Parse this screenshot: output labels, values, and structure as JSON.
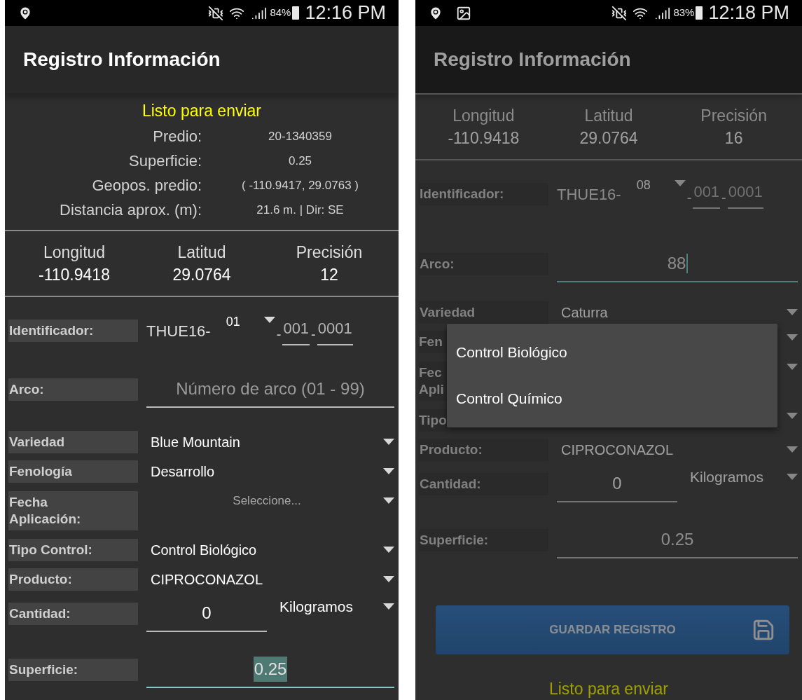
{
  "phones": [
    {
      "dimmed": false,
      "status_bar": {
        "notifications": [
          {
            "kind": "location"
          }
        ],
        "battery": "84%",
        "time": "12:16 PM"
      },
      "title": "Registro Información",
      "info": {
        "status": "Listo para enviar",
        "rows": [
          {
            "label": "Predio:",
            "value": "20-1340359"
          },
          {
            "label": "Superficie:",
            "value": "0.25"
          },
          {
            "label": "Geopos. predio:",
            "value": "( -110.9417, 29.0763 )"
          },
          {
            "label": "Distancia aprox. (m):",
            "value": "21.6 m. | Dir: SE"
          }
        ]
      },
      "gps": [
        {
          "label": "Longitud",
          "value": "-110.9418"
        },
        {
          "label": "Latitud",
          "value": "29.0764"
        },
        {
          "label": "Precisión",
          "value": "12"
        }
      ],
      "form": [
        {
          "kind": "identifier",
          "label": "Identificador:",
          "prefix": "THUE16-",
          "spinner": "01",
          "separators": [
            "-",
            "-"
          ],
          "fields": [
            "001",
            "0001"
          ]
        },
        {
          "kind": "text",
          "label": "Arco:",
          "placeholder": "Número de arco (01 - 99)",
          "focused": false
        },
        {
          "kind": "spinner",
          "label": "Variedad",
          "value": "Blue Mountain"
        },
        {
          "kind": "spinner",
          "label": "Fenología",
          "value": "Desarrollo"
        },
        {
          "kind": "hint_spinner",
          "label": "Fecha\nAplicación:",
          "placeholder": "Seleccione..."
        },
        {
          "kind": "spinner",
          "label": "Tipo Control:",
          "value": "Control Biológico"
        },
        {
          "kind": "spinner",
          "label": "Producto:",
          "value": "CIPROCONAZOL"
        },
        {
          "kind": "quantity",
          "label": "Cantidad:",
          "value": "0",
          "unit": "Kilogramos"
        },
        {
          "kind": "text",
          "label": "Superficie:",
          "value": "0.25",
          "focused": true,
          "highlighted": true
        }
      ]
    },
    {
      "dimmed": true,
      "status_bar": {
        "notifications": [
          {
            "kind": "location"
          },
          {
            "kind": "image"
          }
        ],
        "battery": "83%",
        "time": "12:18 PM"
      },
      "title": "Registro Información",
      "gps": [
        {
          "label": "Longitud",
          "value": "-110.9418"
        },
        {
          "label": "Latitud",
          "value": "29.0764"
        },
        {
          "label": "Precisión",
          "value": "16"
        }
      ],
      "form": [
        {
          "kind": "identifier",
          "label": "Identificador:",
          "prefix": "THUE16-",
          "spinner": "08",
          "separators": [
            "-",
            "-"
          ],
          "fields": [
            "001",
            "0001"
          ]
        },
        {
          "kind": "text",
          "label": "Arco:",
          "value": "88",
          "focused": true,
          "highlighted": false
        },
        {
          "kind": "spinner",
          "label": "Variedad",
          "value": "Caturra"
        },
        {
          "kind": "covered",
          "label": "Fen"
        },
        {
          "kind": "covered",
          "label": "Fec Apli"
        },
        {
          "kind": "covered",
          "label": "Tipo"
        },
        {
          "kind": "spinner",
          "label": "Producto:",
          "value": "CIPROCONAZOL"
        },
        {
          "kind": "quantity",
          "label": "Cantidad:",
          "value": "0",
          "unit": "Kilogramos"
        },
        {
          "kind": "text",
          "label": "Superficie:",
          "value": "0.25",
          "focused": false,
          "highlighted": false
        }
      ],
      "save_button": "GUARDAR REGISTRO",
      "footer_status": "Listo para enviar",
      "popup": {
        "options": [
          "Control Biológico",
          "Control Químico"
        ]
      }
    }
  ]
}
